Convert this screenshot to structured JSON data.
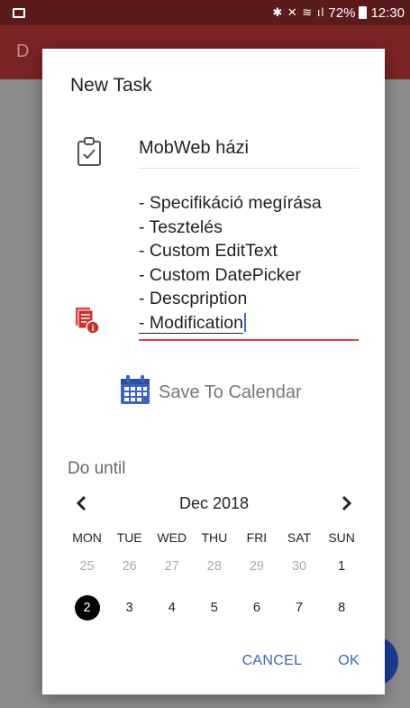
{
  "status_bar": {
    "battery": "72%",
    "time": "12:30",
    "icons": [
      "bluetooth-icon",
      "mute-icon",
      "wifi-icon",
      "signal-icon",
      "battery-icon"
    ]
  },
  "app_bar": {
    "title_initial": "D"
  },
  "dialog": {
    "title": "New Task",
    "task_title": "MobWeb házi",
    "description_lines": [
      "- Specifikáció megírása",
      "- Tesztelés",
      "- Custom EditText",
      "- Custom DatePicker",
      "- Descpription",
      "- Modification"
    ],
    "save_to_calendar": "Save To Calendar",
    "do_until_label": "Do until",
    "calendar": {
      "month_label": "Dec 2018",
      "weekdays": [
        "MON",
        "TUE",
        "WED",
        "THU",
        "FRI",
        "SAT",
        "SUN"
      ],
      "weeks": [
        [
          {
            "d": "25",
            "other": true
          },
          {
            "d": "26",
            "other": true
          },
          {
            "d": "27",
            "other": true
          },
          {
            "d": "28",
            "other": true
          },
          {
            "d": "29",
            "other": true
          },
          {
            "d": "30",
            "other": true
          },
          {
            "d": "1",
            "other": false
          }
        ],
        [
          {
            "d": "2",
            "other": false,
            "selected": true
          },
          {
            "d": "3",
            "other": false
          },
          {
            "d": "4",
            "other": false
          },
          {
            "d": "5",
            "other": false
          },
          {
            "d": "6",
            "other": false
          },
          {
            "d": "7",
            "other": false
          },
          {
            "d": "8",
            "other": false
          }
        ]
      ],
      "selected_day": "2"
    },
    "cancel_label": "CANCEL",
    "ok_label": "OK"
  },
  "colors": {
    "accent_red": "#e3423f",
    "calendar_blue": "#3e62c2",
    "button_blue": "#3b67b8",
    "status_bar": "#5b1a1c",
    "app_bar": "#7a2426"
  }
}
